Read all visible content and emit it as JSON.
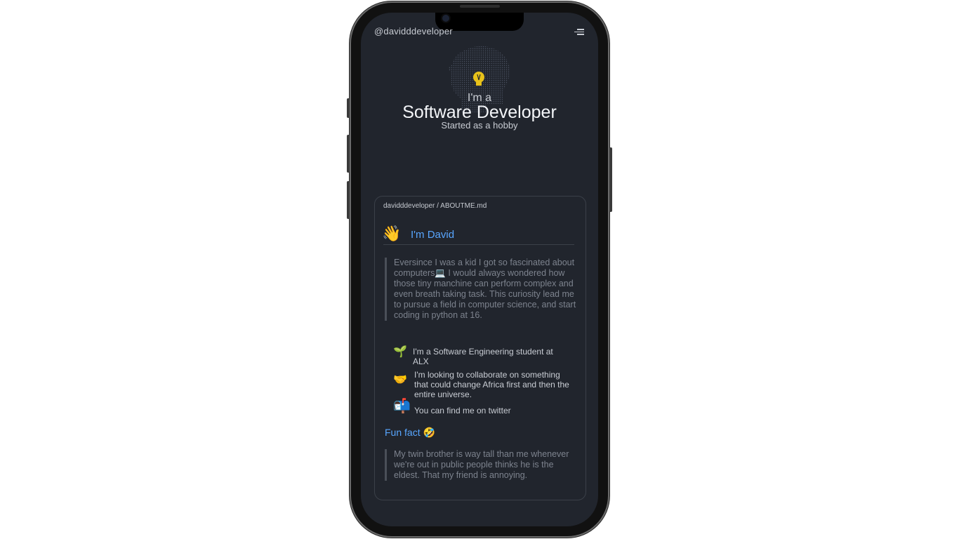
{
  "header": {
    "handle": "@davidddeveloper"
  },
  "hero": {
    "intro": "I'm a",
    "role": "Software Developer",
    "tagline": "Started as a hobby"
  },
  "card": {
    "breadcrumb": "davidddeveloper / ABOUTME.md",
    "greeting": "I'm David",
    "bio": "Eversince I was a kid I got so fascinated about computers💻 I would always wondered how those tiny manchine can perform complex and even breath taking task. This curiosity lead me to pursue a field in computer science, and start coding in python at 16.",
    "items": [
      {
        "text": "I'm a Software Engineering student at ALX",
        "icon": "seedling-icon"
      },
      {
        "text": "I'm looking to collaborate on something that could change Africa first and then the entire universe.",
        "icon": "handshake-icon"
      },
      {
        "text": "You can find me on twitter",
        "icon": "mailbox-icon"
      }
    ],
    "fun_fact_title": "Fun fact",
    "fun_fact": "My twin brother is way tall than me whenever we're out in public people thinks he is the eldest. That my friend is annoying."
  },
  "colors": {
    "accent": "#58a6ff",
    "background": "#21252d",
    "bulb": "#e8c21a"
  }
}
